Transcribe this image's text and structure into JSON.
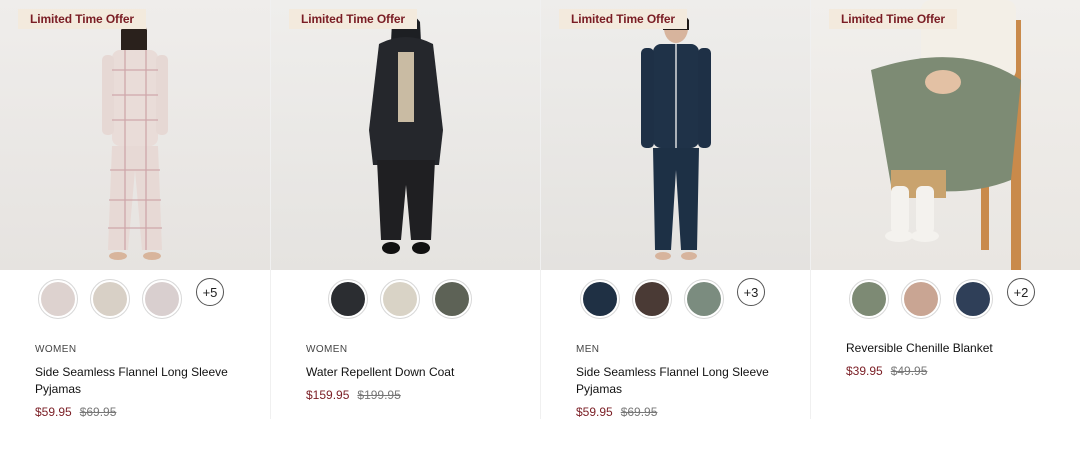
{
  "products": [
    {
      "badge": "Limited Time Offer",
      "category": "WOMEN",
      "name": "Side Seamless Flannel Long Sleeve Pyjamas",
      "price": "$59.95",
      "was": "$69.95",
      "more": "+5",
      "swatches": [
        "#ddd2cf",
        "#d8d0c6",
        "#d9cfcf"
      ]
    },
    {
      "badge": "Limited Time Offer",
      "category": "WOMEN",
      "name": "Water Repellent Down Coat",
      "price": "$159.95",
      "was": "$199.95",
      "more": "",
      "swatches": [
        "#2b2d31",
        "#d9d3c6",
        "#5d6256"
      ]
    },
    {
      "badge": "Limited Time Offer",
      "category": "MEN",
      "name": "Side Seamless Flannel Long Sleeve Pyjamas",
      "price": "$59.95",
      "was": "$69.95",
      "more": "+3",
      "swatches": [
        "#1f3044",
        "#4a3a35",
        "#7b8c7f"
      ]
    },
    {
      "badge": "Limited Time Offer",
      "category": "",
      "name": "Reversible Chenille Blanket",
      "price": "$39.95",
      "was": "$49.95",
      "more": "+2",
      "swatches": [
        "#7d8a74",
        "#c9a593",
        "#2f3f58"
      ]
    }
  ]
}
